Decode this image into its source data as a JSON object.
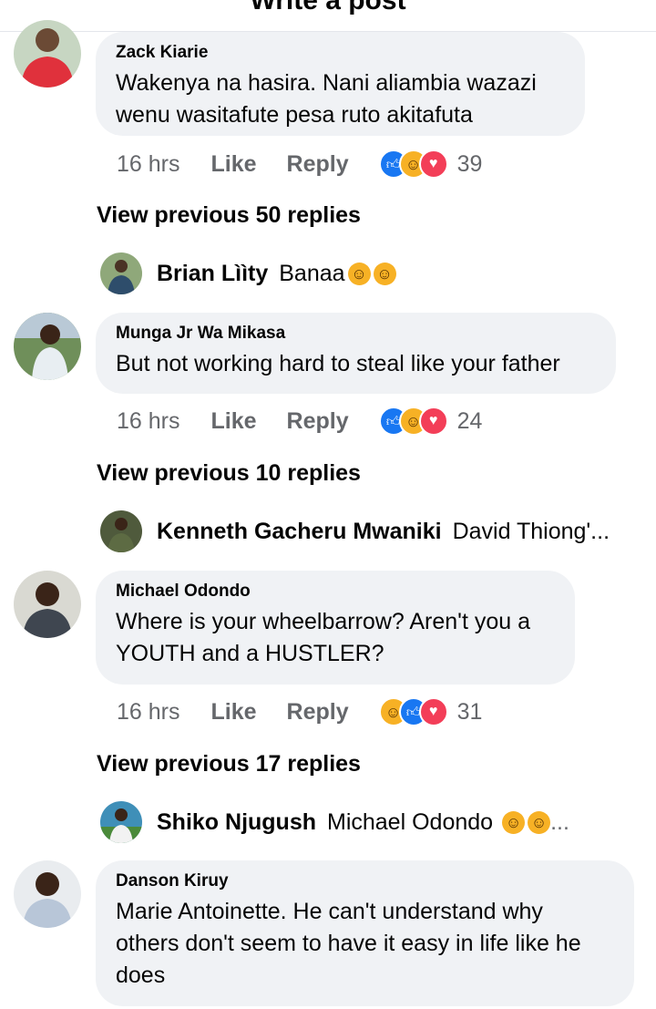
{
  "topbar": {
    "title": "Write a post"
  },
  "comments": [
    {
      "author": "Zack Kiarie",
      "text_lines": [
        "Wakenya na hasira. Nani aliambia wazazi",
        "wenu wasitafute pesa ruto akitafuta"
      ],
      "time": "16 hrs",
      "like_label": "Like",
      "reply_label": "Reply",
      "reaction_icons": [
        "like-icon",
        "haha-icon",
        "love-icon"
      ],
      "reaction_count": "39"
    },
    {
      "author": "Munga Jr Wa Mikasa",
      "text_lines": [
        "But not working hard to steal like your father"
      ],
      "time": "16 hrs",
      "like_label": "Like",
      "reply_label": "Reply",
      "reaction_icons": [
        "like-icon",
        "haha-icon",
        "love-icon"
      ],
      "reaction_count": "24"
    },
    {
      "author": "Michael Odondo",
      "text_lines": [
        "Where is your wheelbarrow? Aren't you a",
        "YOUTH and a HUSTLER?"
      ],
      "time": "16 hrs",
      "like_label": "Like",
      "reply_label": "Reply",
      "reaction_icons": [
        "haha-icon",
        "like-icon",
        "love-icon"
      ],
      "reaction_count": "31"
    },
    {
      "author": "Danson Kiruy",
      "text_lines": [
        "Marie Antoinette. He can't understand why",
        "others don't seem to have it easy in life like he",
        "does"
      ]
    }
  ],
  "view_previous": [
    "View previous 50 replies",
    "View previous 10 replies",
    "View previous 17 replies"
  ],
  "replies": [
    {
      "author": "Brian Lììty",
      "text": "Banaa",
      "emoji_icons": [
        "laughing-tears-icon",
        "laughing-tears-icon"
      ]
    },
    {
      "author": "Kenneth Gacheru Mwaniki",
      "text": "David Thiong'..."
    },
    {
      "author": "Shiko Njugush",
      "text": "Michael Odondo",
      "emoji_icons": [
        "grinning-face-icon",
        "grinning-face-icon"
      ],
      "suffix": "..."
    }
  ],
  "colors": {
    "bubble": "#f0f2f5",
    "muted_text": "#65676b",
    "like_blue": "#1877f2",
    "haha_yellow": "#f7b125",
    "love_red": "#f33e58"
  }
}
